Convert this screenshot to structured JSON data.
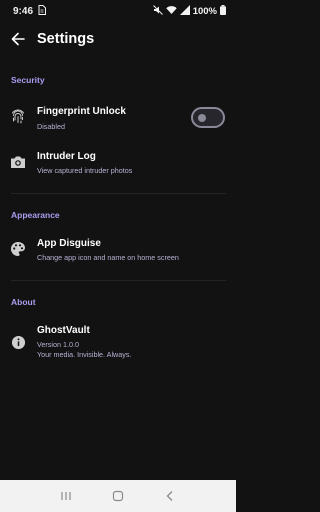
{
  "status_bar": {
    "time": "9:46",
    "battery": "100%",
    "icons": [
      "doc-notification-icon",
      "mute-icon",
      "wifi-icon",
      "signal-icon",
      "battery-icon"
    ]
  },
  "app_bar": {
    "title": "Settings",
    "back_icon": "arrow-back-icon"
  },
  "sections": {
    "security": {
      "title": "Security",
      "fingerprint": {
        "title": "Fingerprint Unlock",
        "subtitle": "Disabled",
        "icon": "fingerprint-icon",
        "toggle_on": false
      },
      "intruder": {
        "title": "Intruder Log",
        "subtitle": "View captured intruder photos",
        "icon": "camera-icon"
      }
    },
    "appearance": {
      "title": "Appearance",
      "disguise": {
        "title": "App Disguise",
        "subtitle": "Change app icon and name on home screen",
        "icon": "palette-icon"
      }
    },
    "about": {
      "title": "About",
      "app": {
        "title": "GhostVault",
        "version": "Version 1.0.0",
        "tagline": "Your media. Invisible. Always.",
        "icon": "info-icon"
      }
    }
  },
  "nav_bar": {
    "icons": [
      "recents-icon",
      "home-icon",
      "back-icon"
    ]
  },
  "colors": {
    "background": "#121212",
    "accent": "#a89df0",
    "navbar": "#f2f2f2"
  }
}
